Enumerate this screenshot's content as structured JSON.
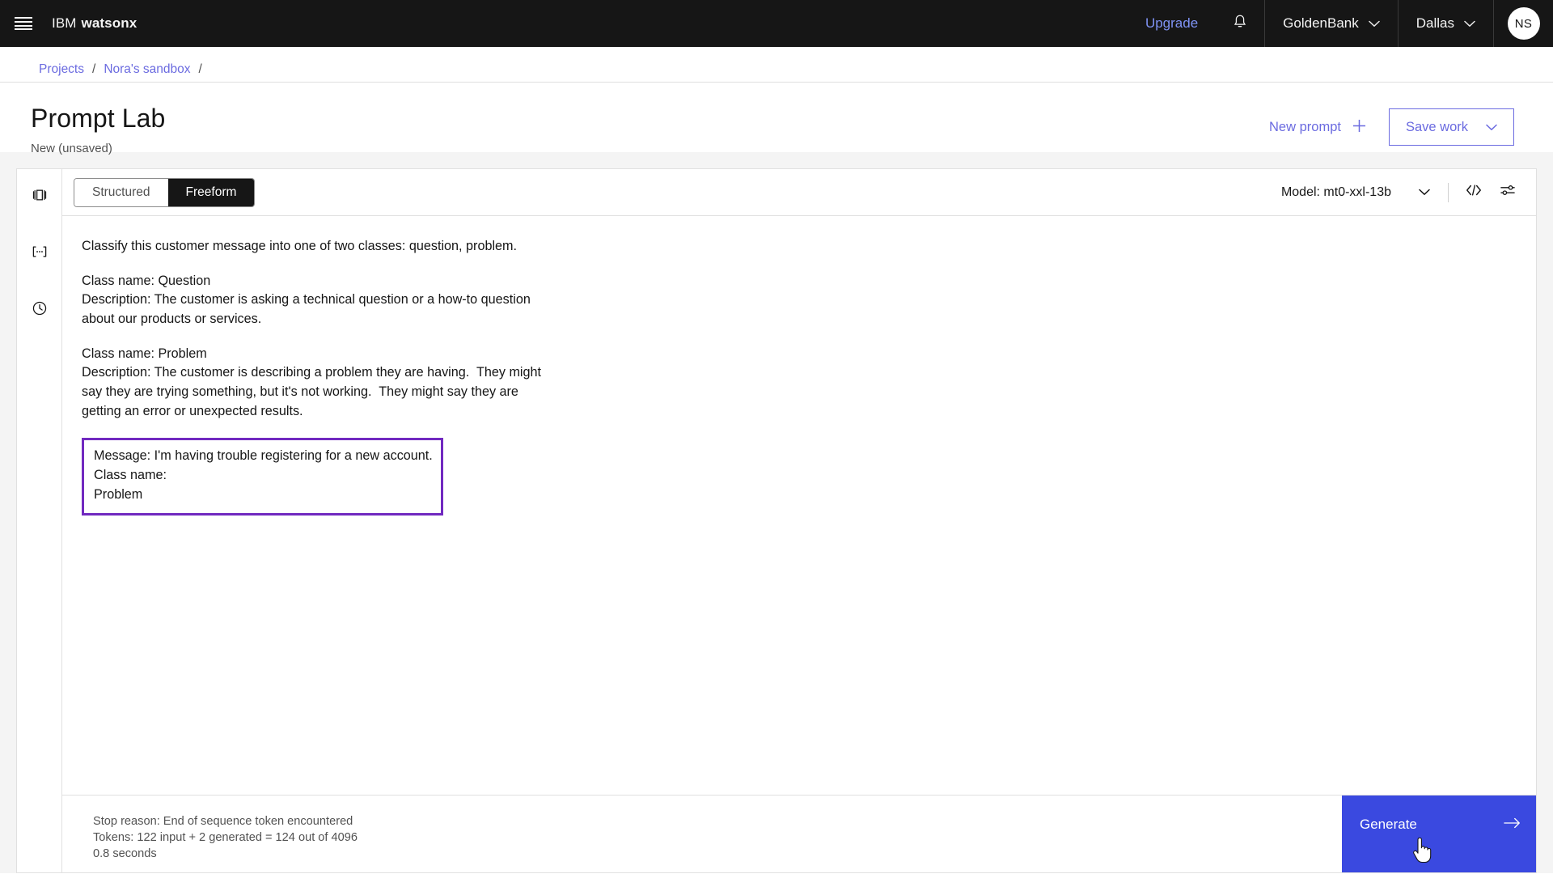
{
  "header": {
    "menu_icon": "hamburger-icon",
    "brand_prefix": "IBM",
    "brand_name": "watsonx",
    "upgrade_label": "Upgrade",
    "notification_icon": "bell-icon",
    "account_label": "GoldenBank",
    "region_label": "Dallas",
    "avatar_initials": "NS"
  },
  "breadcrumb": {
    "items": [
      {
        "label": "Projects"
      },
      {
        "label": "Nora's sandbox"
      }
    ],
    "separator": "/",
    "trailing_separator": "/"
  },
  "page": {
    "title": "Prompt Lab",
    "subtitle": "New (unsaved)",
    "new_prompt_label": "New prompt",
    "new_prompt_icon": "plus-icon",
    "save_work_label": "Save work",
    "save_work_icon": "chevron-down-icon"
  },
  "rail": {
    "items": [
      {
        "icon": "prompt-panel-icon"
      },
      {
        "icon": "variables-icon"
      },
      {
        "icon": "history-clock-icon"
      }
    ]
  },
  "toolbar": {
    "tabs": [
      {
        "label": "Structured",
        "active": false
      },
      {
        "label": "Freeform",
        "active": true
      }
    ],
    "model_label": "Model: mt0-xxl-13b",
    "model_chevron_icon": "chevron-down-icon",
    "code_icon": "code-brackets-icon",
    "settings_icon": "sliders-icon"
  },
  "prompt": {
    "paragraphs": [
      "Classify this customer message into one of two classes: question, problem.",
      "Class name: Question\nDescription: The customer is asking a technical question or a how-to question\nabout our products or services.",
      "Class name: Problem\nDescription: The customer is describing a problem they are having.  They might\nsay they are trying something, but it's not working.  They might say they are\ngetting an error or unexpected results."
    ],
    "generated_block": "Message: I'm having trouble registering for a new account.\nClass name:\nProblem",
    "generated_border_color": "#7129c0"
  },
  "status": {
    "stop_reason": "Stop reason: End of sequence token encountered",
    "tokens": "Tokens: 122 input + 2 generated = 124 out of 4096",
    "duration": "0.8 seconds"
  },
  "generate": {
    "label": "Generate",
    "icon": "arrow-right-icon",
    "color": "#3a49e0"
  }
}
